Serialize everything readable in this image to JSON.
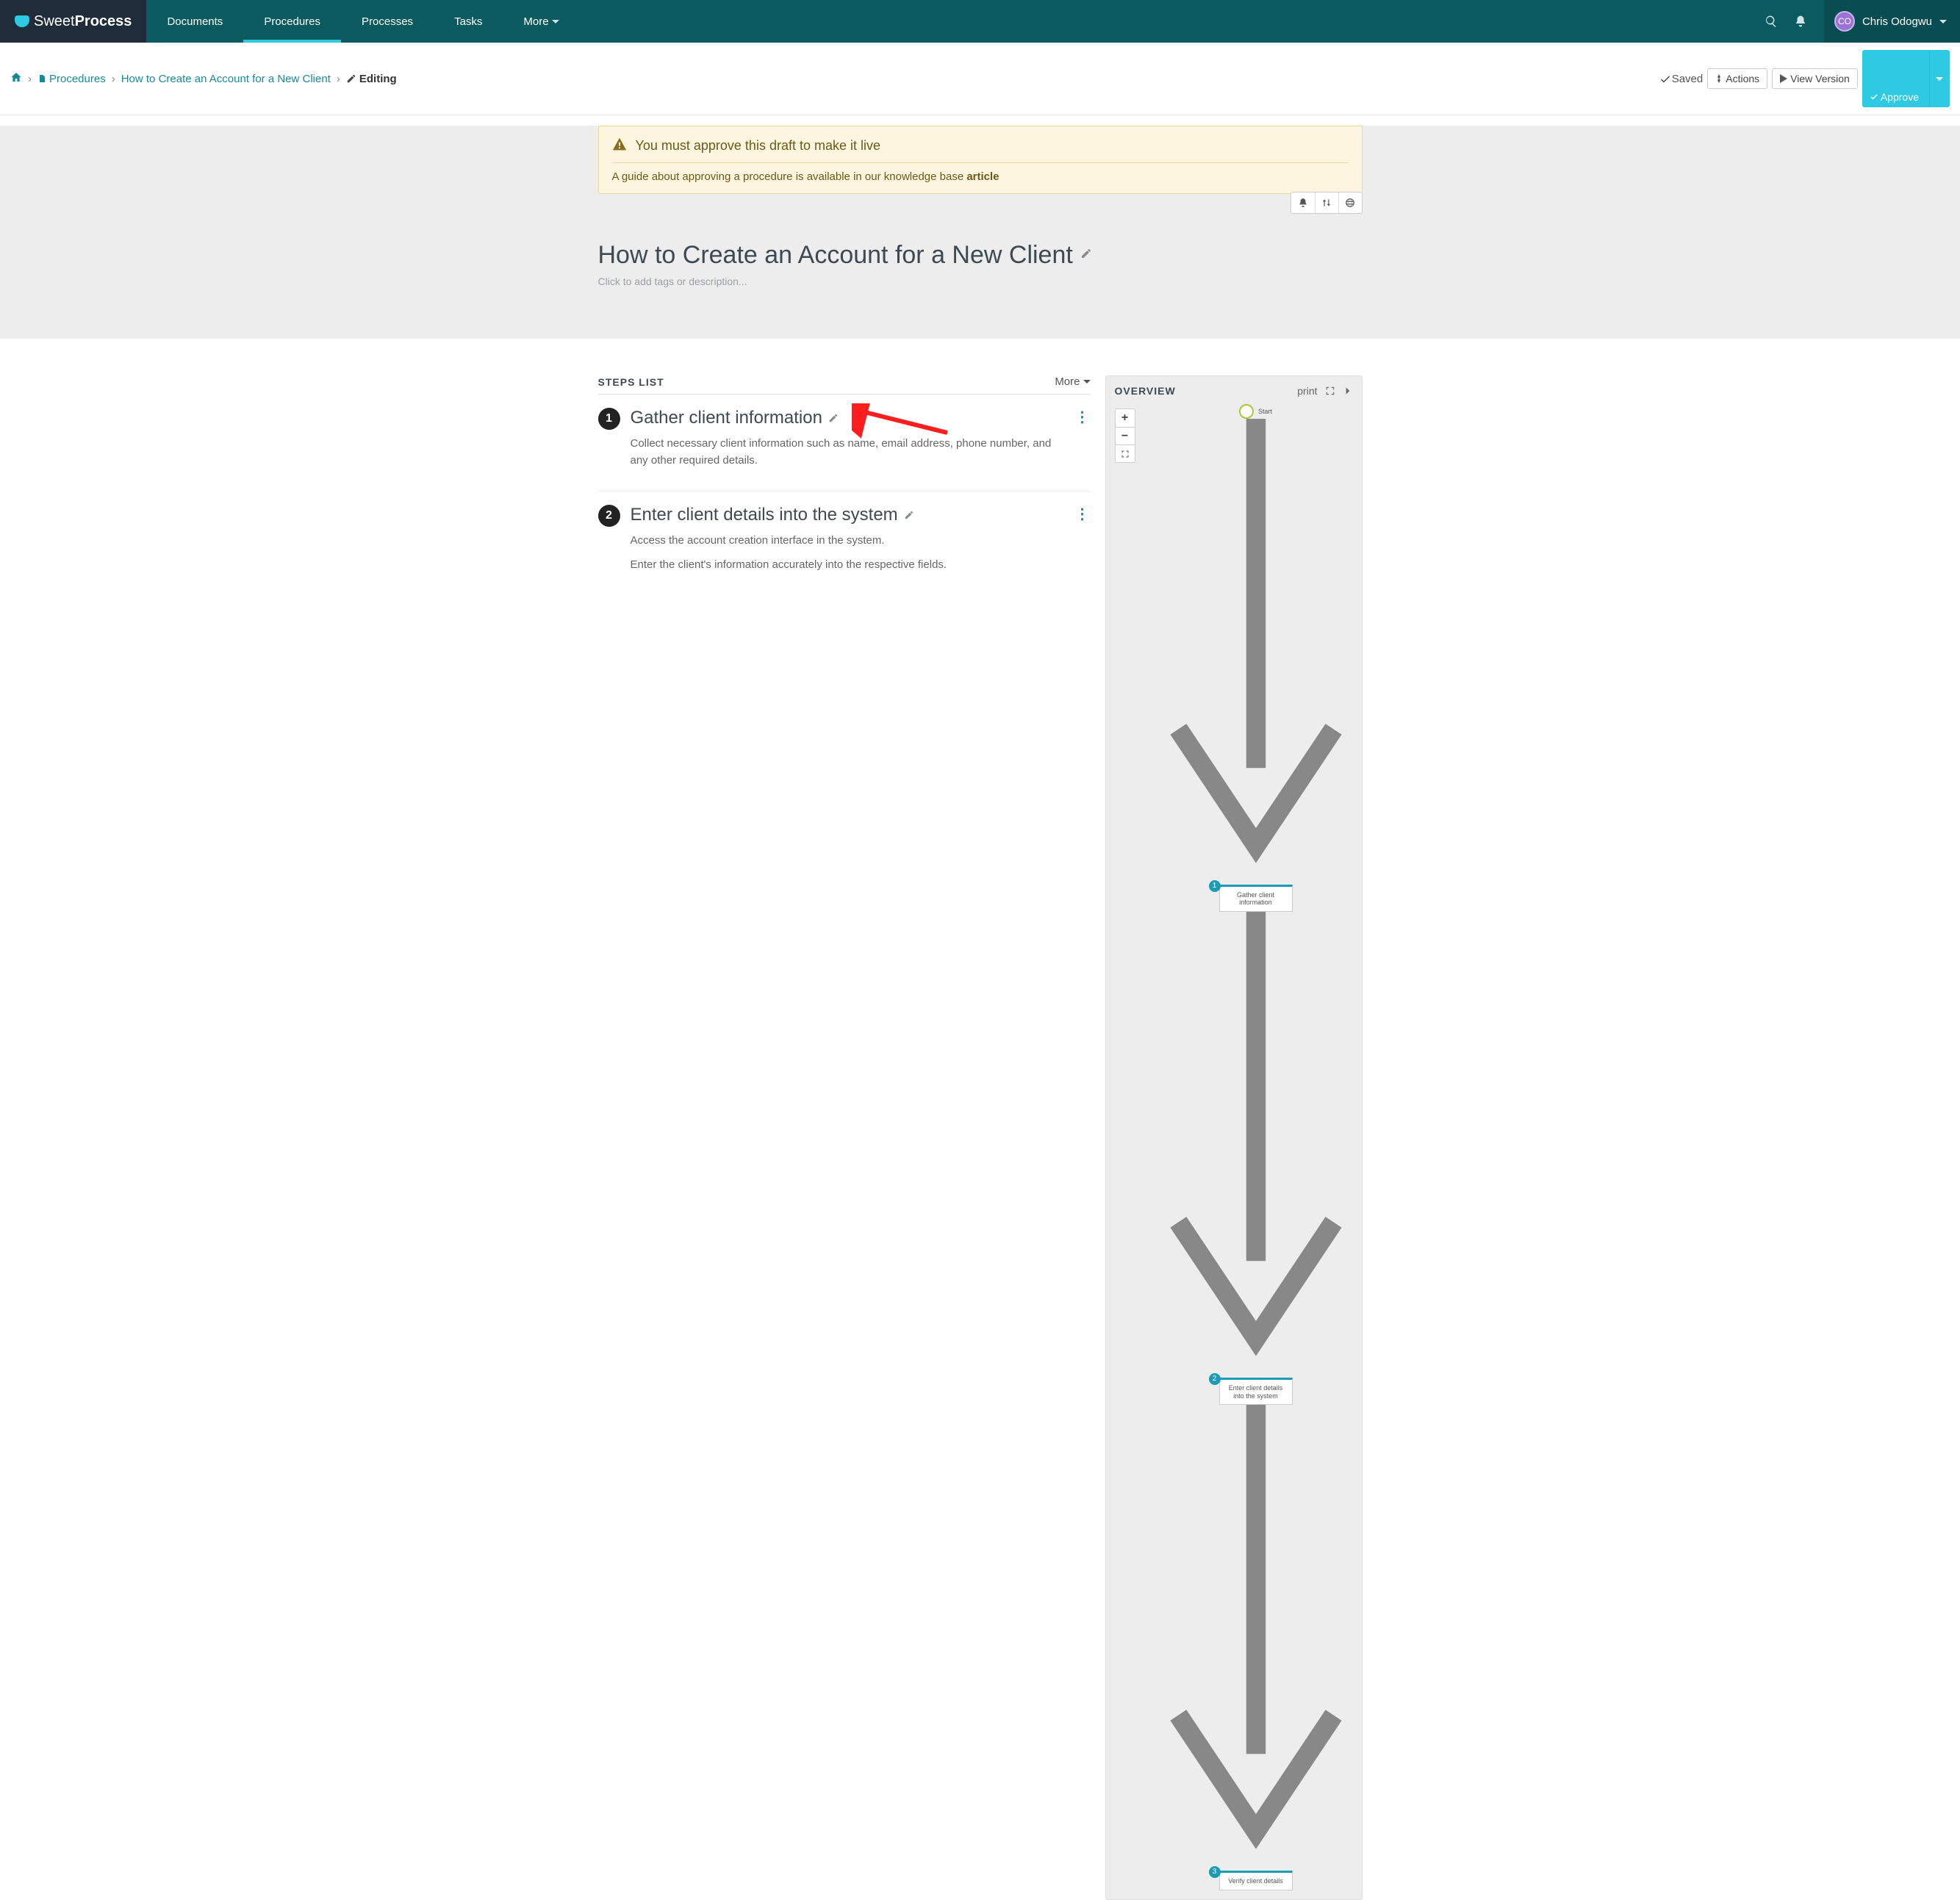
{
  "brand": {
    "light": "Sweet",
    "bold": "Process"
  },
  "nav": {
    "items": [
      "Documents",
      "Procedures",
      "Processes",
      "Tasks"
    ],
    "more": "More",
    "user": {
      "initials": "CO",
      "name": "Chris Odogwu"
    }
  },
  "breadcrumb": {
    "procedures": "Procedures",
    "title": "How to Create an Account for a New Client",
    "editing": "Editing"
  },
  "subactions": {
    "saved": "Saved",
    "actions": "Actions",
    "view_version": "View Version",
    "approve": "Approve"
  },
  "alert": {
    "title": "You must approve this draft to make it live",
    "sub_pre": "A guide about approving a procedure is available in our knowledge base ",
    "sub_link": "article"
  },
  "page": {
    "title": "How to Create an Account for a New Client",
    "tags_placeholder": "Click to add tags or description..."
  },
  "steps_header": {
    "title": "STEPS LIST",
    "more": "More"
  },
  "steps": [
    {
      "num": "1",
      "title": "Gather client information",
      "desc": [
        "Collect necessary client information such as name, email address, phone number, and any other required details."
      ]
    },
    {
      "num": "2",
      "title": "Enter client details into the system",
      "desc": [
        "Access the account creation interface in the system.",
        "Enter the client's information accurately into the respective fields."
      ]
    }
  ],
  "overview": {
    "title": "OVERVIEW",
    "print": "print",
    "start": "Start",
    "nodes": [
      {
        "n": "1",
        "label": "Gather client information"
      },
      {
        "n": "2",
        "label": "Enter client details into the system"
      },
      {
        "n": "3",
        "label": "Verify client details"
      }
    ]
  }
}
